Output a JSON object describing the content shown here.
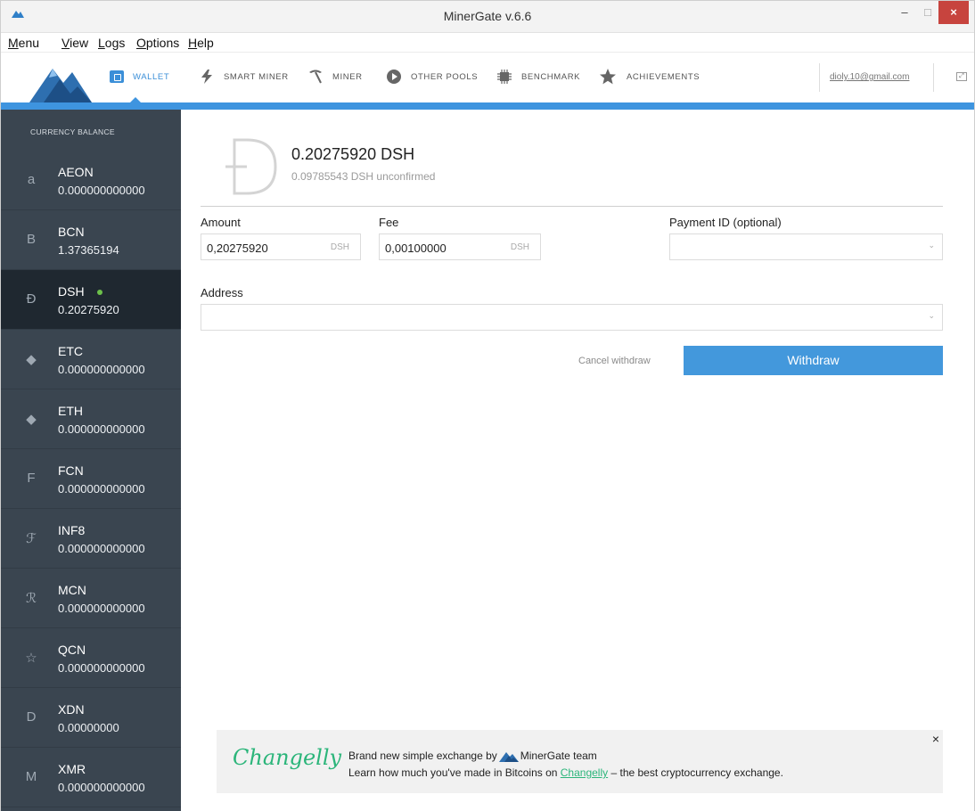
{
  "window": {
    "title": "MinerGate v.6.6",
    "min_glyph": "–",
    "max_glyph": "□",
    "close_glyph": "×"
  },
  "menubar": [
    "Menu",
    "View",
    "Logs",
    "Options",
    "Help"
  ],
  "toolbar": {
    "nav": [
      {
        "label": "WALLET",
        "icon": "wallet-icon",
        "active": true
      },
      {
        "label": "SMART MINER",
        "icon": "lightning-icon",
        "active": false
      },
      {
        "label": "MINER",
        "icon": "pickaxe-icon",
        "active": false
      },
      {
        "label": "OTHER POOLS",
        "icon": "pools-icon",
        "active": false
      },
      {
        "label": "BENCHMARK",
        "icon": "chip-icon",
        "active": false
      },
      {
        "label": "ACHIEVEMENTS",
        "icon": "star-icon",
        "active": false
      }
    ],
    "user_email": "dioly.10@gmail.com",
    "expand_glyph": "⤢"
  },
  "sidebar": {
    "header": "CURRENCY BALANCE",
    "currencies": [
      {
        "symbol": "a",
        "name": "AEON",
        "balance": "0.000000000000",
        "active": false
      },
      {
        "symbol": "B",
        "name": "BCN",
        "balance": "1.37365194",
        "active": false
      },
      {
        "symbol": "Đ",
        "name": "DSH",
        "balance": "0.20275920",
        "active": true
      },
      {
        "symbol": "◆",
        "name": "ETC",
        "balance": "0.000000000000",
        "active": false
      },
      {
        "symbol": "◆",
        "name": "ETH",
        "balance": "0.000000000000",
        "active": false
      },
      {
        "symbol": "F",
        "name": "FCN",
        "balance": "0.000000000000",
        "active": false
      },
      {
        "symbol": "ℱ",
        "name": "INF8",
        "balance": "0.000000000000",
        "active": false
      },
      {
        "symbol": "ℛ",
        "name": "MCN",
        "balance": "0.000000000000",
        "active": false
      },
      {
        "symbol": "☆",
        "name": "QCN",
        "balance": "0.000000000000",
        "active": false
      },
      {
        "symbol": "D",
        "name": "XDN",
        "balance": "0.00000000",
        "active": false
      },
      {
        "symbol": "M",
        "name": "XMR",
        "balance": "0.000000000000",
        "active": false
      }
    ]
  },
  "main": {
    "balance": "0.20275920 DSH",
    "unconfirmed": "0.09785543 DSH unconfirmed",
    "amount": {
      "label": "Amount",
      "value": "0,20275920",
      "unit": "DSH"
    },
    "fee": {
      "label": "Fee",
      "value": "0,00100000",
      "unit": "DSH"
    },
    "payment_id": {
      "label": "Payment ID (optional)",
      "value": ""
    },
    "address": {
      "label": "Address",
      "value": ""
    },
    "cancel_label": "Cancel withdraw",
    "withdraw_label": "Withdraw"
  },
  "banner": {
    "logo_text": "Changelly",
    "line1_prefix": "Brand new simple exchange by",
    "line1_brand": "MinerGate team",
    "line2_prefix": "Learn how much you've made in Bitcoins on",
    "line2_link": "Changelly",
    "line2_suffix": "– the best cryptocurrency exchange.",
    "close_glyph": "×"
  },
  "colors": {
    "accent": "#3e94df",
    "sidebar_bg": "#3a4550",
    "sidebar_active": "#1f2830",
    "online_dot": "#6cc04a",
    "changelly_green": "#2bb57a"
  }
}
